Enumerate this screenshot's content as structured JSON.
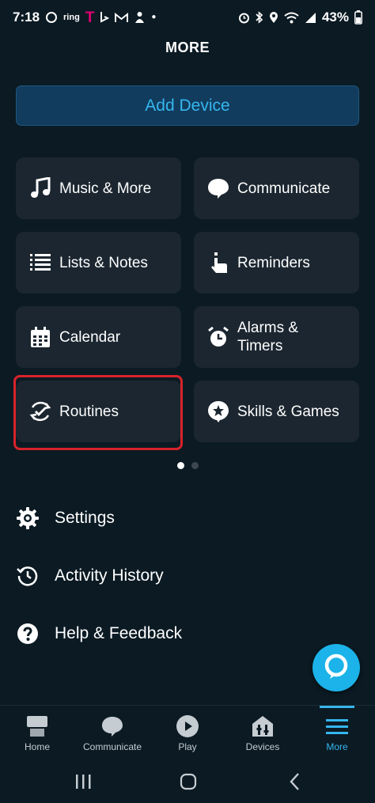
{
  "status_bar": {
    "time": "7:18",
    "ring_label": "ring",
    "tmobile_label": "T",
    "battery": "43%"
  },
  "page": {
    "title": "MORE"
  },
  "add_device": {
    "label": "Add Device"
  },
  "tiles": [
    {
      "label": "Music & More",
      "icon": "music-note-icon"
    },
    {
      "label": "Communicate",
      "icon": "speech-bubble-icon"
    },
    {
      "label": "Lists & Notes",
      "icon": "list-icon"
    },
    {
      "label": "Reminders",
      "icon": "reminder-hand-icon"
    },
    {
      "label": "Calendar",
      "icon": "calendar-icon"
    },
    {
      "label": "Alarms & Timers",
      "icon": "alarm-clock-icon"
    },
    {
      "label": "Routines",
      "icon": "routine-check-icon",
      "highlighted": true
    },
    {
      "label": "Skills & Games",
      "icon": "skills-star-icon"
    }
  ],
  "pager": {
    "pages": 2,
    "active_index": 0
  },
  "list": [
    {
      "label": "Settings",
      "icon": "gear-icon"
    },
    {
      "label": "Activity History",
      "icon": "history-icon"
    },
    {
      "label": "Help & Feedback",
      "icon": "help-icon"
    }
  ],
  "bottom_nav": [
    {
      "label": "Home",
      "icon": "home-icon"
    },
    {
      "label": "Communicate",
      "icon": "speech-bubble-icon"
    },
    {
      "label": "Play",
      "icon": "play-icon"
    },
    {
      "label": "Devices",
      "icon": "devices-icon"
    },
    {
      "label": "More",
      "icon": "menu-icon",
      "active": true
    }
  ],
  "colors": {
    "background": "#0b1a23",
    "tile": "#1b2630",
    "accent": "#35b6ee",
    "highlight": "#d8232a",
    "alexa": "#1bb3e9"
  }
}
